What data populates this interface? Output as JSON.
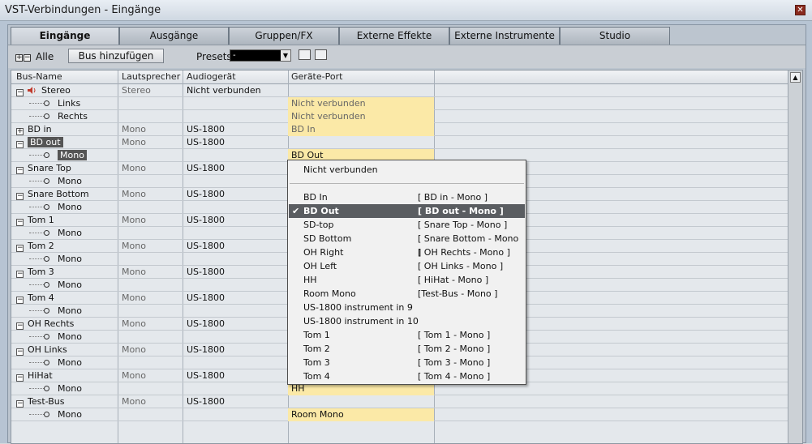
{
  "window": {
    "title": "VST-Verbindungen - Eingänge",
    "close_glyph": "✕"
  },
  "tabs": [
    {
      "label": "Eingänge",
      "active": true
    },
    {
      "label": "Ausgänge"
    },
    {
      "label": "Gruppen/FX"
    },
    {
      "label": "Externe Effekte"
    },
    {
      "label": "Externe Instrumente"
    },
    {
      "label": "Studio"
    }
  ],
  "toolbar": {
    "expand_all_label": "Alle",
    "add_bus_label": "Bus hinzufügen",
    "presets_label": "Presets",
    "preset_value": "-"
  },
  "table": {
    "columns": [
      "Bus-Name",
      "Lautsprecher",
      "Audiogerät",
      "Geräte-Port"
    ],
    "rows": [
      {
        "name": "Stereo",
        "level": 0,
        "icon": "speaker-icon",
        "speaker": "Stereo",
        "device": "Nicht verbunden",
        "port": ""
      },
      {
        "name": "Links",
        "level": 1,
        "speaker": "",
        "device": "",
        "port": "Nicht verbunden",
        "port_highlight": true,
        "port_muted": true
      },
      {
        "name": "Rechts",
        "level": 1,
        "speaker": "",
        "device": "",
        "port": "Nicht verbunden",
        "port_highlight": true,
        "port_muted": true
      },
      {
        "name": "BD in",
        "level": 0,
        "collapsed": true,
        "speaker": "Mono",
        "device": "US-1800",
        "port": "BD In",
        "port_highlight": true,
        "port_muted": true
      },
      {
        "name": "BD out",
        "level": 0,
        "selected": true,
        "speaker": "Mono",
        "device": "US-1800",
        "port": ""
      },
      {
        "name": "Mono",
        "level": 1,
        "selected": true,
        "speaker": "",
        "device": "",
        "port": "BD Out",
        "port_highlight": true
      },
      {
        "name": "Snare Top",
        "level": 0,
        "speaker": "Mono",
        "device": "US-1800",
        "port": ""
      },
      {
        "name": "Mono",
        "level": 1,
        "speaker": "",
        "device": "",
        "port": ""
      },
      {
        "name": "Snare Bottom",
        "level": 0,
        "speaker": "Mono",
        "device": "US-1800",
        "port": ""
      },
      {
        "name": "Mono",
        "level": 1,
        "speaker": "",
        "device": "",
        "port": ""
      },
      {
        "name": "Tom 1",
        "level": 0,
        "speaker": "Mono",
        "device": "US-1800",
        "port": ""
      },
      {
        "name": "Mono",
        "level": 1,
        "speaker": "",
        "device": "",
        "port": ""
      },
      {
        "name": "Tom 2",
        "level": 0,
        "speaker": "Mono",
        "device": "US-1800",
        "port": ""
      },
      {
        "name": "Mono",
        "level": 1,
        "speaker": "",
        "device": "",
        "port": ""
      },
      {
        "name": "Tom 3",
        "level": 0,
        "speaker": "Mono",
        "device": "US-1800",
        "port": ""
      },
      {
        "name": "Mono",
        "level": 1,
        "speaker": "",
        "device": "",
        "port": ""
      },
      {
        "name": "Tom 4",
        "level": 0,
        "speaker": "Mono",
        "device": "US-1800",
        "port": ""
      },
      {
        "name": "Mono",
        "level": 1,
        "speaker": "",
        "device": "",
        "port": ""
      },
      {
        "name": "OH Rechts",
        "level": 0,
        "speaker": "Mono",
        "device": "US-1800",
        "port": ""
      },
      {
        "name": "Mono",
        "level": 1,
        "speaker": "",
        "device": "",
        "port": ""
      },
      {
        "name": "OH Links",
        "level": 0,
        "speaker": "Mono",
        "device": "US-1800",
        "port": ""
      },
      {
        "name": "Mono",
        "level": 1,
        "speaker": "",
        "device": "",
        "port": ""
      },
      {
        "name": "HiHat",
        "level": 0,
        "speaker": "Mono",
        "device": "US-1800",
        "port": ""
      },
      {
        "name": "Mono",
        "level": 1,
        "speaker": "",
        "device": "",
        "port": "HH",
        "port_highlight": true
      },
      {
        "name": "Test-Bus",
        "level": 0,
        "speaker": "Mono",
        "device": "US-1800",
        "port": ""
      },
      {
        "name": "Mono",
        "level": 1,
        "speaker": "",
        "device": "",
        "port": "Room Mono",
        "port_highlight": true
      }
    ]
  },
  "dropdown": {
    "items": [
      {
        "label": "Nicht verbunden",
        "assigned": ""
      },
      {
        "separator": true
      },
      {
        "label": "BD In",
        "assigned": "[ BD in - Mono ]"
      },
      {
        "label": "BD Out",
        "assigned": "[ BD out - Mono ]",
        "selected": true
      },
      {
        "label": "SD-top",
        "assigned": "[ Snare Top - Mono ]"
      },
      {
        "label": "SD Bottom",
        "assigned": "[ Snare Bottom - Mono ]"
      },
      {
        "label": "OH Right",
        "assigned": "[ OH Rechts - Mono ]"
      },
      {
        "label": "OH Left",
        "assigned": "[ OH Links - Mono ]"
      },
      {
        "label": "HH",
        "assigned": "[ HiHat - Mono ]"
      },
      {
        "label": "Room Mono",
        "assigned": "[Test-Bus - Mono ]"
      },
      {
        "label": "US-1800 instrument in 9",
        "assigned": ""
      },
      {
        "label": "US-1800 instrument in 10",
        "assigned": ""
      },
      {
        "label": "Tom 1",
        "assigned": "[ Tom 1 - Mono ]"
      },
      {
        "label": "Tom 2",
        "assigned": "[ Tom 2 - Mono ]"
      },
      {
        "label": "Tom 3",
        "assigned": "[ Tom 3 - Mono ]"
      },
      {
        "label": "Tom 4",
        "assigned": "[ Tom 4 - Mono ]"
      }
    ]
  },
  "colors": {
    "port_highlight": "#fbe9a7",
    "selection": "#555555",
    "menu_selected": "#5a5d61"
  }
}
